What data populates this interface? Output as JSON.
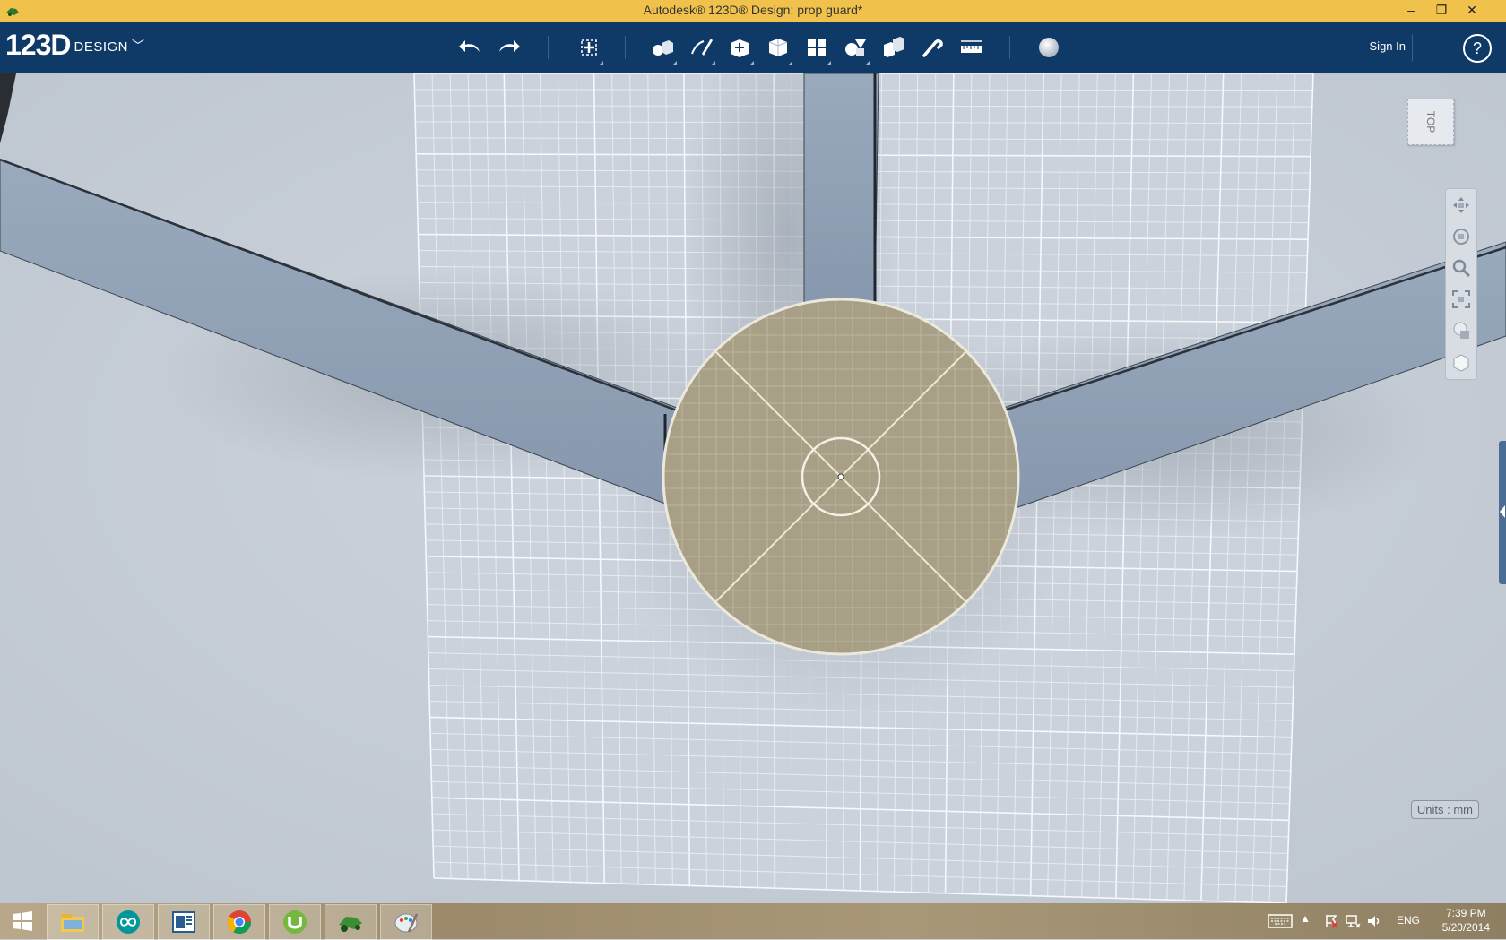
{
  "window": {
    "title": "Autodesk® 123D® Design: prop guard*",
    "controls": {
      "minimize": "–",
      "restore": "❐",
      "close": "✕"
    }
  },
  "logo": {
    "number": "123D",
    "word": "DESIGN",
    "chevron": "﹀"
  },
  "toolbar": {
    "tools": [
      "undo-icon",
      "redo-icon",
      "transform-icon",
      "primitives-icon",
      "sketch-icon",
      "construct-icon",
      "modify-icon",
      "pattern-icon",
      "grouping-icon",
      "combine-icon",
      "snap-icon",
      "measure-icon",
      "material-icon"
    ],
    "signin_label": "Sign In",
    "help_label": "?"
  },
  "viewcube": {
    "label": "TOP"
  },
  "navbar": {
    "buttons": [
      "pan-icon",
      "orbit-icon",
      "zoom-icon",
      "fit-icon",
      "visibility-icon",
      "material-view-icon"
    ]
  },
  "status": {
    "units_label": "Units : mm"
  },
  "taskbar": {
    "apps": [
      "windows-start-icon",
      "file-explorer-icon",
      "arduino-icon",
      "reader-icon",
      "chrome-icon",
      "utorrent-icon",
      "123d-design-icon",
      "paint-icon"
    ],
    "language": "ENG",
    "time": "7:39 PM",
    "date": "5/20/2014"
  },
  "colors": {
    "titlebar": "#f0c24b",
    "toolbar": "#0f3a68",
    "viewport": "#c6cdd6",
    "arm": "#8fa0b5",
    "hub": "#a79f86"
  }
}
